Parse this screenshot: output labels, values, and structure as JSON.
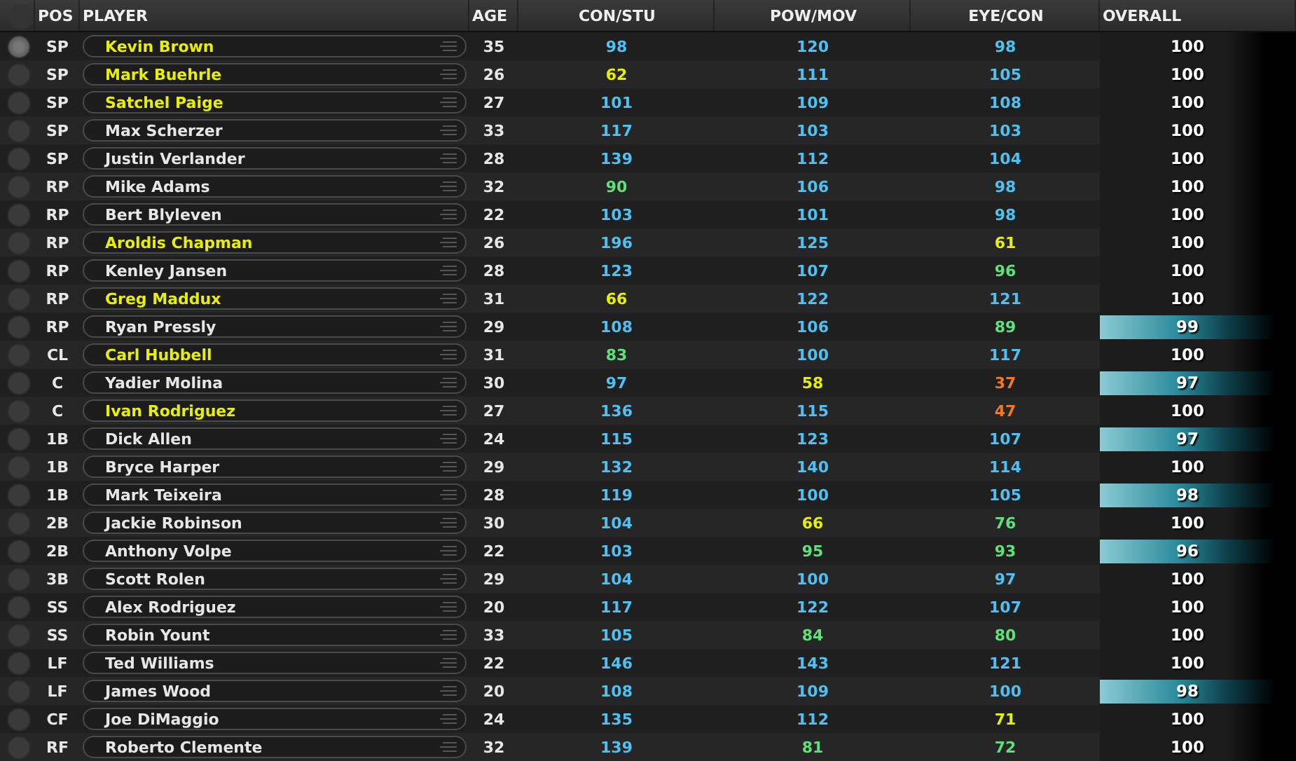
{
  "header_selected": false,
  "columns": [
    "POS",
    "PLAYER",
    "AGE",
    "CON/STU",
    "POW/MOV",
    "EYE/CON",
    "OVERALL"
  ],
  "rows": [
    {
      "selected": true,
      "pos": "SP",
      "name": "Kevin Brown",
      "highlighted": true,
      "age": "35",
      "stats": [
        "98",
        "120",
        "98"
      ],
      "overall": "100",
      "below_max": false
    },
    {
      "selected": false,
      "pos": "SP",
      "name": "Mark Buehrle",
      "highlighted": true,
      "age": "26",
      "stats": [
        "62",
        "111",
        "105"
      ],
      "overall": "100",
      "below_max": false
    },
    {
      "selected": false,
      "pos": "SP",
      "name": "Satchel Paige",
      "highlighted": true,
      "age": "27",
      "stats": [
        "101",
        "109",
        "108"
      ],
      "overall": "100",
      "below_max": false
    },
    {
      "selected": false,
      "pos": "SP",
      "name": "Max Scherzer",
      "highlighted": false,
      "age": "33",
      "stats": [
        "117",
        "103",
        "103"
      ],
      "overall": "100",
      "below_max": false
    },
    {
      "selected": false,
      "pos": "SP",
      "name": "Justin Verlander",
      "highlighted": false,
      "age": "28",
      "stats": [
        "139",
        "112",
        "104"
      ],
      "overall": "100",
      "below_max": false
    },
    {
      "selected": false,
      "pos": "RP",
      "name": "Mike Adams",
      "highlighted": false,
      "age": "32",
      "stats": [
        "90",
        "106",
        "98"
      ],
      "overall": "100",
      "below_max": false
    },
    {
      "selected": false,
      "pos": "RP",
      "name": "Bert Blyleven",
      "highlighted": false,
      "age": "22",
      "stats": [
        "103",
        "101",
        "98"
      ],
      "overall": "100",
      "below_max": false
    },
    {
      "selected": false,
      "pos": "RP",
      "name": "Aroldis Chapman",
      "highlighted": true,
      "age": "26",
      "stats": [
        "196",
        "125",
        "61"
      ],
      "overall": "100",
      "below_max": false
    },
    {
      "selected": false,
      "pos": "RP",
      "name": "Kenley Jansen",
      "highlighted": false,
      "age": "28",
      "stats": [
        "123",
        "107",
        "96"
      ],
      "overall": "100",
      "below_max": false
    },
    {
      "selected": false,
      "pos": "RP",
      "name": "Greg Maddux",
      "highlighted": true,
      "age": "31",
      "stats": [
        "66",
        "122",
        "121"
      ],
      "overall": "100",
      "below_max": false
    },
    {
      "selected": false,
      "pos": "RP",
      "name": "Ryan Pressly",
      "highlighted": false,
      "age": "29",
      "stats": [
        "108",
        "106",
        "89"
      ],
      "overall": "99",
      "below_max": true
    },
    {
      "selected": false,
      "pos": "CL",
      "name": "Carl Hubbell",
      "highlighted": true,
      "age": "31",
      "stats": [
        "83",
        "100",
        "117"
      ],
      "overall": "100",
      "below_max": false
    },
    {
      "selected": false,
      "pos": "C",
      "name": "Yadier Molina",
      "highlighted": false,
      "age": "30",
      "stats": [
        "97",
        "58",
        "37"
      ],
      "overall": "97",
      "below_max": true
    },
    {
      "selected": false,
      "pos": "C",
      "name": "Ivan Rodriguez",
      "highlighted": true,
      "age": "27",
      "stats": [
        "136",
        "115",
        "47"
      ],
      "overall": "100",
      "below_max": false
    },
    {
      "selected": false,
      "pos": "1B",
      "name": "Dick Allen",
      "highlighted": false,
      "age": "24",
      "stats": [
        "115",
        "123",
        "107"
      ],
      "overall": "97",
      "below_max": true
    },
    {
      "selected": false,
      "pos": "1B",
      "name": "Bryce Harper",
      "highlighted": false,
      "age": "29",
      "stats": [
        "132",
        "140",
        "114"
      ],
      "overall": "100",
      "below_max": false
    },
    {
      "selected": false,
      "pos": "1B",
      "name": "Mark Teixeira",
      "highlighted": false,
      "age": "28",
      "stats": [
        "119",
        "100",
        "105"
      ],
      "overall": "98",
      "below_max": true
    },
    {
      "selected": false,
      "pos": "2B",
      "name": "Jackie Robinson",
      "highlighted": false,
      "age": "30",
      "stats": [
        "104",
        "66",
        "76"
      ],
      "overall": "100",
      "below_max": false
    },
    {
      "selected": false,
      "pos": "2B",
      "name": "Anthony Volpe",
      "highlighted": false,
      "age": "22",
      "stats": [
        "103",
        "95",
        "93"
      ],
      "overall": "96",
      "below_max": true
    },
    {
      "selected": false,
      "pos": "3B",
      "name": "Scott Rolen",
      "highlighted": false,
      "age": "29",
      "stats": [
        "104",
        "100",
        "97"
      ],
      "overall": "100",
      "below_max": false
    },
    {
      "selected": false,
      "pos": "SS",
      "name": "Alex Rodriguez",
      "highlighted": false,
      "age": "20",
      "stats": [
        "117",
        "122",
        "107"
      ],
      "overall": "100",
      "below_max": false
    },
    {
      "selected": false,
      "pos": "SS",
      "name": "Robin Yount",
      "highlighted": false,
      "age": "33",
      "stats": [
        "105",
        "84",
        "80"
      ],
      "overall": "100",
      "below_max": false
    },
    {
      "selected": false,
      "pos": "LF",
      "name": "Ted Williams",
      "highlighted": false,
      "age": "22",
      "stats": [
        "146",
        "143",
        "121"
      ],
      "overall": "100",
      "below_max": false
    },
    {
      "selected": false,
      "pos": "LF",
      "name": "James Wood",
      "highlighted": false,
      "age": "20",
      "stats": [
        "108",
        "109",
        "100"
      ],
      "overall": "98",
      "below_max": true
    },
    {
      "selected": false,
      "pos": "CF",
      "name": "Joe DiMaggio",
      "highlighted": false,
      "age": "24",
      "stats": [
        "135",
        "112",
        "71"
      ],
      "overall": "100",
      "below_max": false
    },
    {
      "selected": false,
      "pos": "RF",
      "name": "Roberto Clemente",
      "highlighted": false,
      "age": "32",
      "stats": [
        "139",
        "81",
        "72"
      ],
      "overall": "100",
      "below_max": false
    }
  ]
}
